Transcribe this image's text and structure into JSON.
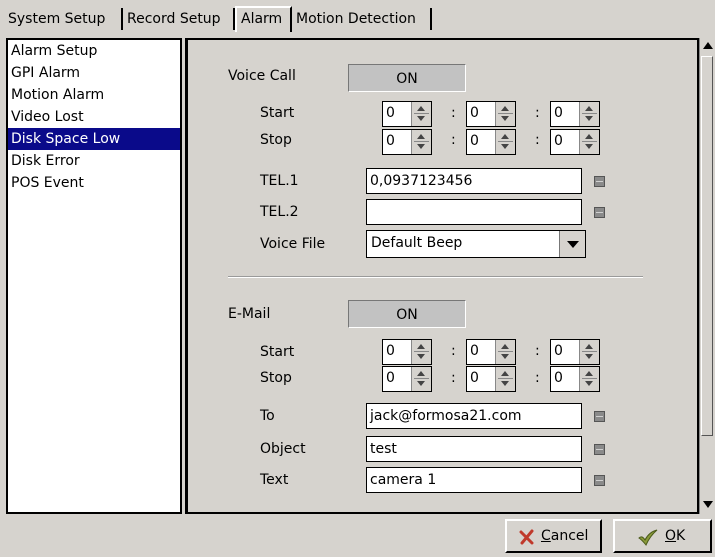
{
  "tabs": [
    {
      "label": "System Setup"
    },
    {
      "label": "Record Setup"
    },
    {
      "label": "Alarm"
    },
    {
      "label": "Motion Detection"
    }
  ],
  "sidebar": {
    "items": [
      {
        "label": "Alarm Setup"
      },
      {
        "label": "GPI Alarm"
      },
      {
        "label": "Motion Alarm"
      },
      {
        "label": "Video Lost"
      },
      {
        "label": "Disk Space Low"
      },
      {
        "label": "Disk Error"
      },
      {
        "label": "POS Event"
      }
    ],
    "selected": "Disk Space Low"
  },
  "voice_call": {
    "label": "Voice Call",
    "state": "ON",
    "start_label": "Start",
    "stop_label": "Stop",
    "start": [
      "0",
      "0",
      "0"
    ],
    "stop": [
      "0",
      "0",
      "0"
    ],
    "tel1_label": "TEL.1",
    "tel1_value": "0,0937123456",
    "tel2_label": "TEL.2",
    "tel2_value": "",
    "voice_file_label": "Voice File",
    "voice_file_value": "Default Beep"
  },
  "email": {
    "label": "E-Mail",
    "state": "ON",
    "start_label": "Start",
    "stop_label": "Stop",
    "start": [
      "0",
      "0",
      "0"
    ],
    "stop": [
      "0",
      "0",
      "0"
    ],
    "to_label": "To",
    "to_value": "jack@formosa21.com",
    "object_label": "Object",
    "object_value": "test",
    "text_label": "Text",
    "text_value": "camera 1"
  },
  "buttons": {
    "cancel": "Cancel",
    "ok": "OK"
  },
  "icons": {
    "cancel": "x-icon",
    "ok": "check-icon",
    "keyboard": "keyboard-icon"
  },
  "colors": {
    "background": "#d6d3ce",
    "selection": "#0a0a8a",
    "cancel_icon": "#c0392b",
    "ok_icon": "#6b7f2a"
  }
}
